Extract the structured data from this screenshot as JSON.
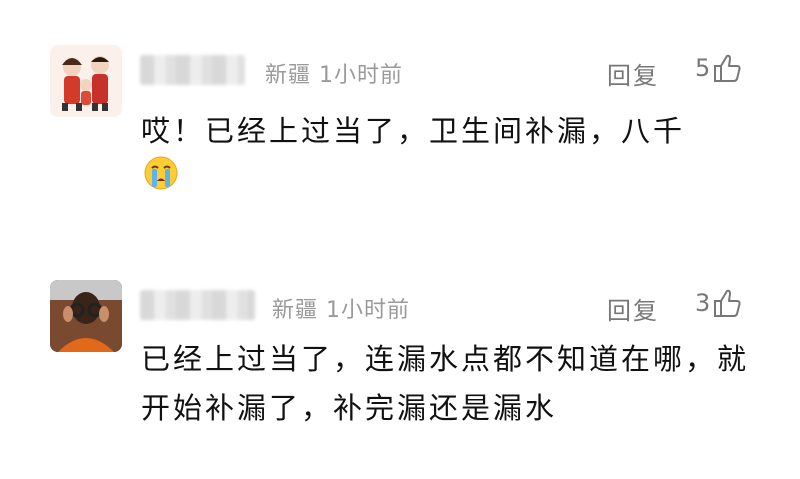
{
  "comments": [
    {
      "location": "新疆",
      "time": "1小时前",
      "reply_label": "回复",
      "likes": "5",
      "text": "哎！已经上过当了，卫生间补漏，八千",
      "emoji": "crying-face-emoji"
    },
    {
      "location": "新疆",
      "time": "1小时前",
      "reply_label": "回复",
      "likes": "3",
      "text": "已经上过当了，连漏水点都不知道在哪，就开始补漏了，补完漏还是漏水"
    }
  ]
}
